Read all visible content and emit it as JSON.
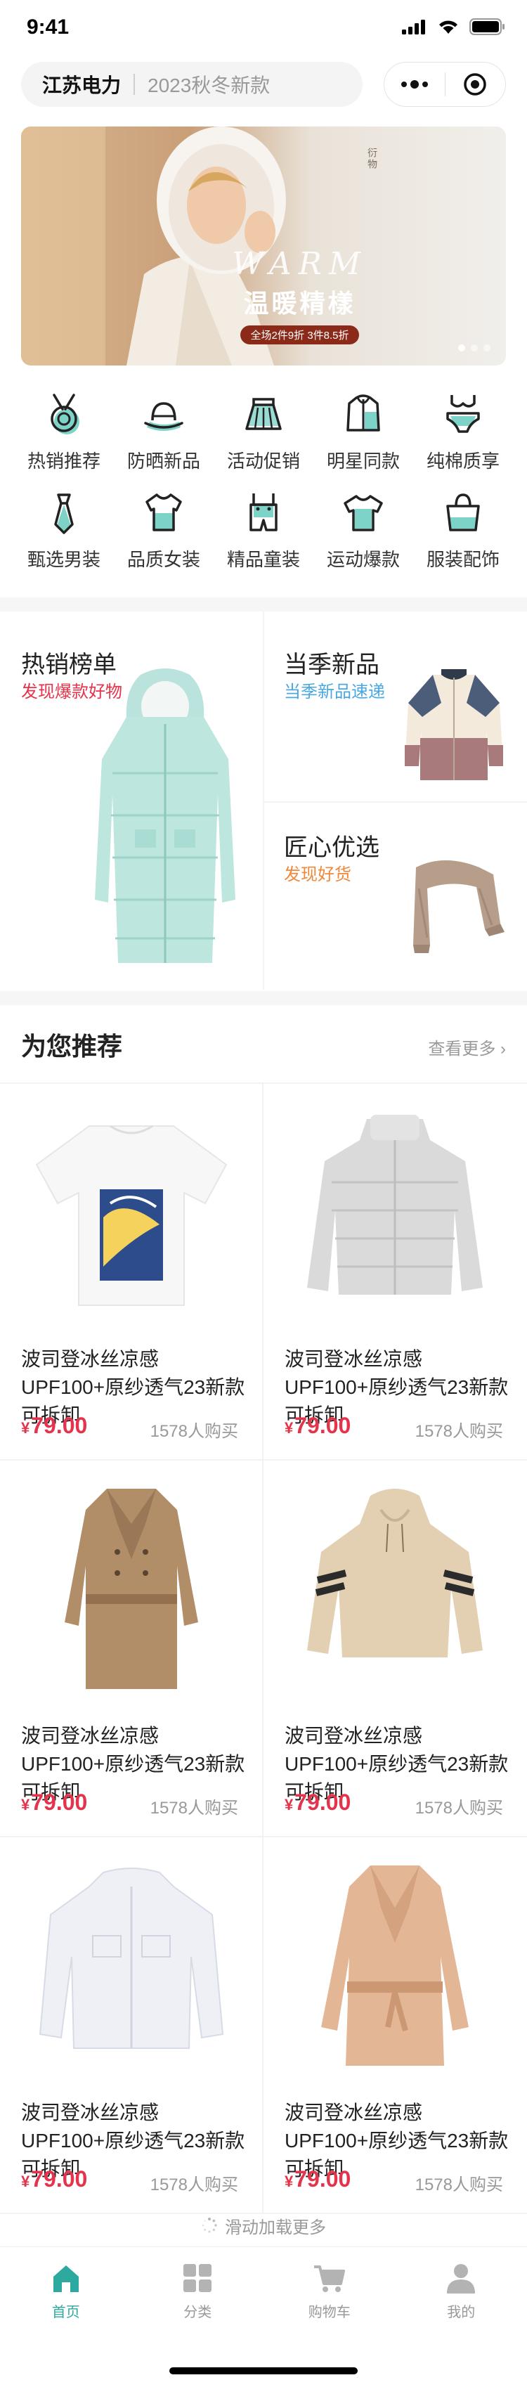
{
  "status_bar": {
    "time": "9:41"
  },
  "header": {
    "city": "江苏电力",
    "placeholder": "2023秋冬新款"
  },
  "banner": {
    "script_text": "WARM",
    "title": "温暖精樣",
    "date_badge": "全场2件9折 3件8.5折",
    "side_text": "衍物"
  },
  "categories": [
    {
      "label": "热销推荐",
      "icon": "medal-icon"
    },
    {
      "label": "防晒新品",
      "icon": "bucket-hat-icon"
    },
    {
      "label": "活动促销",
      "icon": "skirt-icon"
    },
    {
      "label": "明星同款",
      "icon": "jacket-icon"
    },
    {
      "label": "纯棉质享",
      "icon": "underwear-icon"
    },
    {
      "label": "甄选男装",
      "icon": "necktie-icon"
    },
    {
      "label": "品质女装",
      "icon": "blouse-icon"
    },
    {
      "label": "精品童装",
      "icon": "overalls-icon"
    },
    {
      "label": "运动爆款",
      "icon": "tshirt-icon"
    },
    {
      "label": "服装配饰",
      "icon": "handbag-icon"
    }
  ],
  "features": {
    "hot": {
      "title": "热销榜单",
      "subtitle": "发现爆款好物"
    },
    "new": {
      "title": "当季新品",
      "subtitle": "当季新品速递"
    },
    "craft": {
      "title": "匠心优选",
      "subtitle": "发现好货"
    }
  },
  "recommend": {
    "title": "为您推荐",
    "more": "查看更多",
    "products": [
      {
        "title": "波司登冰丝凉感UPF100+原纱透气23新款可拆卸",
        "currency": "¥",
        "price": "79.00",
        "sold": "1578人购买"
      },
      {
        "title": "波司登冰丝凉感UPF100+原纱透气23新款可拆卸",
        "currency": "¥",
        "price": "79.00",
        "sold": "1578人购买"
      },
      {
        "title": "波司登冰丝凉感UPF100+原纱透气23新款可拆卸",
        "currency": "¥",
        "price": "79.00",
        "sold": "1578人购买"
      },
      {
        "title": "波司登冰丝凉感UPF100+原纱透气23新款可拆卸",
        "currency": "¥",
        "price": "79.00",
        "sold": "1578人购买"
      },
      {
        "title": "波司登冰丝凉感UPF100+原纱透气23新款可拆卸",
        "currency": "¥",
        "price": "79.00",
        "sold": "1578人购买"
      },
      {
        "title": "波司登冰丝凉感UPF100+原纱透气23新款可拆卸",
        "currency": "¥",
        "price": "79.00",
        "sold": "1578人购买"
      }
    ]
  },
  "loading_text": "滑动加载更多",
  "tabbar": {
    "tabs": [
      {
        "label": "首页",
        "icon": "home-icon"
      },
      {
        "label": "分类",
        "icon": "category-grid-icon"
      },
      {
        "label": "购物车",
        "icon": "cart-icon"
      },
      {
        "label": "我的",
        "icon": "user-icon"
      }
    ]
  },
  "colors": {
    "accent": "#2ea9a0",
    "price": "#e5334b",
    "hot_sub": "#e5334b",
    "new_sub": "#4aa8e0",
    "craft_sub": "#f0883a"
  }
}
